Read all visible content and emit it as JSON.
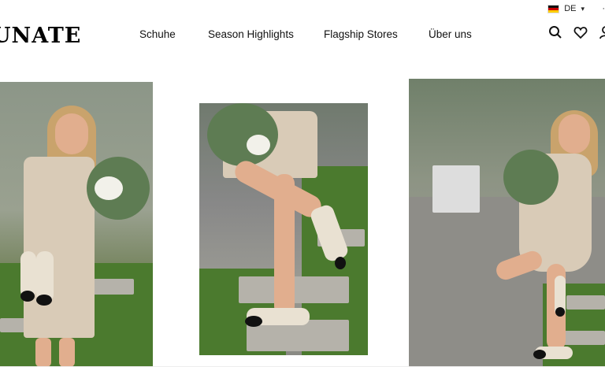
{
  "topbar": {
    "language": "DE",
    "language_extra": "·"
  },
  "header": {
    "logo": "UNATE",
    "nav": [
      {
        "label": "Schuhe"
      },
      {
        "label": "Season Highlights"
      },
      {
        "label": "Flagship Stores"
      },
      {
        "label": "Über uns"
      }
    ],
    "icons": [
      "search-icon",
      "heart-icon",
      "user-icon"
    ]
  },
  "gallery": {
    "images": [
      "product-photo-woman-holding-shoes",
      "product-photo-legs-on-stepping-stones",
      "product-photo-woman-posing-garden"
    ]
  },
  "colors": {
    "text": "#111111",
    "background": "#ffffff"
  }
}
